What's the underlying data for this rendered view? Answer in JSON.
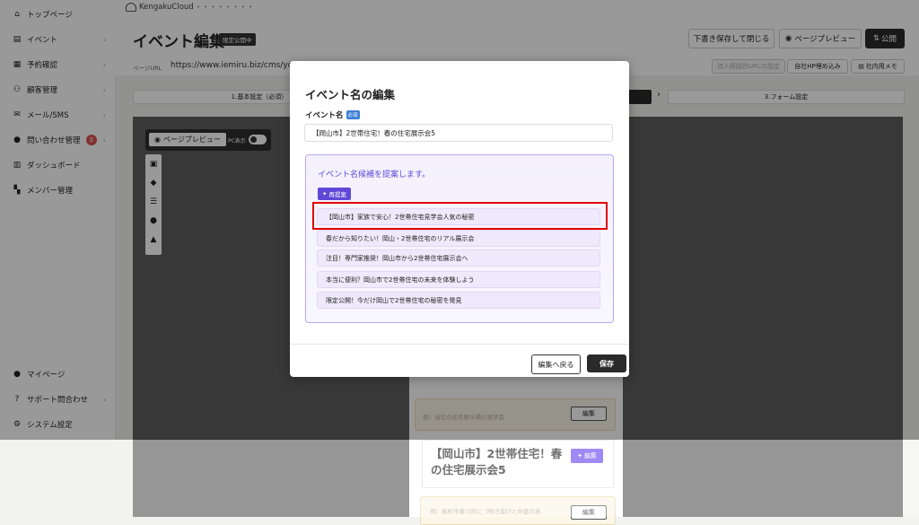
{
  "app": {
    "logo_text": "KengakuCloud",
    "logo_dots": "• • • • • • • •"
  },
  "sidebar": {
    "items": [
      {
        "label": "トップページ",
        "icon": "home-icon",
        "glyph": "⌂"
      },
      {
        "label": "イベント",
        "icon": "document-icon",
        "glyph": "▤"
      },
      {
        "label": "予約確認",
        "icon": "calendar-icon",
        "glyph": "▦"
      },
      {
        "label": "顧客管理",
        "icon": "users-icon",
        "glyph": "⚇"
      },
      {
        "label": "メール/SMS",
        "icon": "mail-icon",
        "glyph": "✉"
      },
      {
        "label": "問い合わせ管理",
        "icon": "chat-icon",
        "glyph": "●",
        "badge": "3"
      },
      {
        "label": "ダッシュボード",
        "icon": "chart-icon",
        "glyph": "▥"
      },
      {
        "label": "メンバー管理",
        "icon": "grid-icon",
        "glyph": "▚"
      },
      {
        "label": "マイページ",
        "icon": "person-icon",
        "glyph": "👤"
      },
      {
        "label": "サポート問合わせ",
        "icon": "help-icon",
        "glyph": "?"
      },
      {
        "label": "システム設定",
        "icon": "gear-icon",
        "glyph": "⚙"
      }
    ]
  },
  "header": {
    "title": "イベント編集",
    "status_badge": "限定公開中",
    "save_close": "下書き保存して閉じる",
    "page_preview": "ページプレビュー",
    "publish": "公開"
  },
  "url_row": {
    "label": "ページURL",
    "value": "https://www.iemiru.biz/cms/yo",
    "btn_embed_setting": "流入経路別URLの設定",
    "btn_hp_embed": "自社HP埋め込み",
    "btn_internal_memo": "社内用メモ"
  },
  "steps": {
    "step1": "1.基本設定（必須）",
    "step3": "3.フォーム設定"
  },
  "canvas": {
    "preview_btn": "ページプレビュー",
    "pc_label": "PC表示"
  },
  "preview": {
    "hint1": "例）当社の住宅展示場の見学会",
    "edit": "編集",
    "event_title": "【岡山市】2世帯住宅！春の住宅展示会5",
    "hint2": "例）高松市香川町に《吹き抜けと中庭のあ"
  },
  "modal": {
    "title": "イベント名の編集",
    "field_label": "イベント名",
    "required": "必須",
    "input_value": "【岡山市】2世帯住宅！春の住宅展示会5",
    "suggest_heading": "イベント名候補を提案します。",
    "regen": "再提案",
    "suggestions": [
      "【岡山市】家族で安心！2世帯住宅見学会人気の秘密",
      "春だから知りたい！岡山・2世帯住宅のリアル展示会",
      "注目！専門家推奨！岡山市から2世帯住宅展示会へ",
      "本当に便利？岡山市で2世帯住宅の未来を体験しよう",
      "限定公開！今だけ岡山で2世帯住宅の秘密を発見"
    ],
    "back": "編集へ戻る",
    "save": "保存"
  }
}
